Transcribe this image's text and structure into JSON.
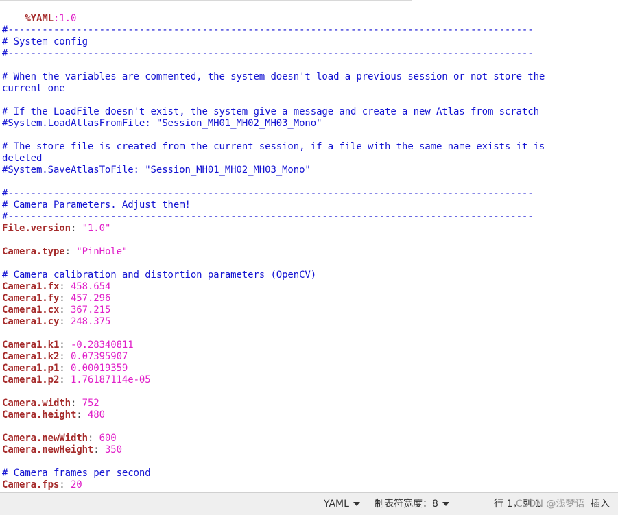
{
  "directive": {
    "name": "%YAML",
    "value": "1.0"
  },
  "separator": "#--------------------------------------------------------------------------------------------",
  "sections": {
    "system_header": "# System config",
    "system_comment_1a": "# When the variables are commented, the system doesn't load a previous session or not store the",
    "system_comment_1b": "current one",
    "system_comment_2": "# If the LoadFile doesn't exist, the system give a message and create a new Atlas from scratch",
    "system_load_line": "#System.LoadAtlasFromFile: \"Session_MH01_MH02_MH03_Mono\"",
    "system_comment_3a": "# The store file is created from the current session, if a file with the same name exists it is",
    "system_comment_3b": "deleted",
    "system_save_line": "#System.SaveAtlasToFile: \"Session_MH01_MH02_MH03_Mono\"",
    "camera_header": "# Camera Parameters. Adjust them!",
    "calib_comment": "# Camera calibration and distortion parameters (OpenCV)",
    "fps_comment": "# Camera frames per second"
  },
  "entries": {
    "file_version": {
      "key": "File.version",
      "value": "\"1.0\""
    },
    "camera_type": {
      "key": "Camera.type",
      "value": "\"PinHole\""
    },
    "fx": {
      "key": "Camera1.fx",
      "value": "458.654"
    },
    "fy": {
      "key": "Camera1.fy",
      "value": "457.296"
    },
    "cx": {
      "key": "Camera1.cx",
      "value": "367.215"
    },
    "cy": {
      "key": "Camera1.cy",
      "value": "248.375"
    },
    "k1": {
      "key": "Camera1.k1",
      "value": "-0.28340811"
    },
    "k2": {
      "key": "Camera1.k2",
      "value": "0.07395907"
    },
    "p1": {
      "key": "Camera1.p1",
      "value": "0.00019359"
    },
    "p2": {
      "key": "Camera1.p2",
      "value": "1.76187114e-05"
    },
    "width": {
      "key": "Camera.width",
      "value": "752"
    },
    "height": {
      "key": "Camera.height",
      "value": "480"
    },
    "new_width": {
      "key": "Camera.newWidth",
      "value": "600"
    },
    "new_height": {
      "key": "Camera.newHeight",
      "value": "350"
    },
    "fps": {
      "key": "Camera.fps",
      "value": "20"
    }
  },
  "statusbar": {
    "language": "YAML",
    "tab_width_label": "制表符宽度：",
    "tab_width_value": "8",
    "position": "行 1，列 1",
    "watermark": "CSDN @浅梦语",
    "insert_mode": "插入"
  },
  "colors": {
    "comment": "#1414d2",
    "key": "#a52a2a",
    "value": "#e020c8",
    "statusbar_bg": "#efefef"
  }
}
